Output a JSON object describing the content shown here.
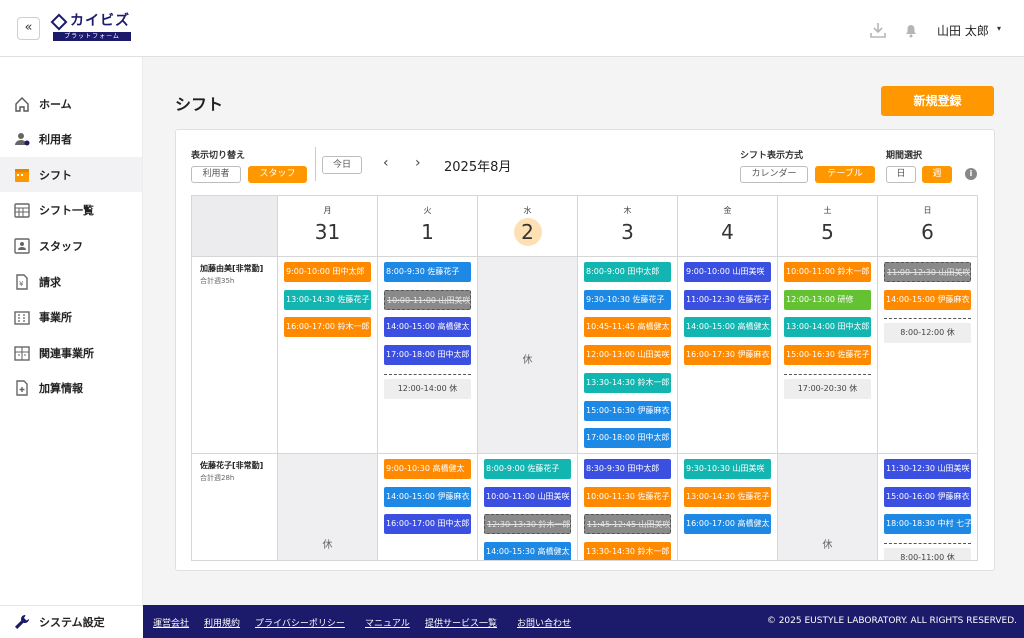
{
  "header": {
    "collapse_glyph": "«",
    "logo_main": "カイビズ",
    "logo_sub": "プラットフォーム",
    "user_name": "山田 太郎",
    "caret": "▾"
  },
  "sidebar": {
    "items": [
      {
        "label": "ホーム",
        "icon": "home-icon"
      },
      {
        "label": "利用者",
        "icon": "user-icon"
      },
      {
        "label": "シフト",
        "icon": "calendar-icon",
        "active": true
      },
      {
        "label": "シフト一覧",
        "icon": "calendar-grid-icon"
      },
      {
        "label": "スタッフ",
        "icon": "staff-card-icon"
      },
      {
        "label": "請求",
        "icon": "invoice-icon"
      },
      {
        "label": "事業所",
        "icon": "building-icon"
      },
      {
        "label": "関連事業所",
        "icon": "related-office-icon"
      },
      {
        "label": "加算情報",
        "icon": "document-plus-icon"
      }
    ],
    "system_setting": "システム設定"
  },
  "page": {
    "title": "シフト",
    "new_button": "新規登録"
  },
  "controls": {
    "view_switch_label": "表示切り替え",
    "view_user": "利用者",
    "view_staff": "スタッフ",
    "today": "今日",
    "prev": "‹",
    "next": "›",
    "month": "2025年8月",
    "display_mode_label": "シフト表示方式",
    "mode_calendar": "カレンダー",
    "mode_table": "テーブル",
    "period_label": "期間選択",
    "period_day": "日",
    "period_week": "週",
    "info": "i"
  },
  "colors": {
    "accent": "#ff9800",
    "navy": "#1b1a6b",
    "blue": "#3b50e0",
    "lightblue": "#1e88e5",
    "teal": "#12b5b0",
    "orange": "#ff8a00",
    "green": "#63c132",
    "gray": "#8a8a8a"
  },
  "days": [
    {
      "dow": "月",
      "num": "31"
    },
    {
      "dow": "火",
      "num": "1"
    },
    {
      "dow": "水",
      "num": "2",
      "today": true
    },
    {
      "dow": "木",
      "num": "3"
    },
    {
      "dow": "金",
      "num": "4"
    },
    {
      "dow": "土",
      "num": "5"
    },
    {
      "dow": "日",
      "num": "6"
    }
  ],
  "staff": [
    {
      "name": "加藤由美[非常勤]",
      "hours": "合計週35h"
    },
    {
      "name": "佐藤花子[非常勤]",
      "hours": "合計週28h"
    }
  ],
  "off_label": "休",
  "rows": [
    [
      {
        "shifts": [
          {
            "text": "9:00-10:00 田中太郎",
            "color": "orange"
          },
          {
            "text": "13:00-14:30 佐藤花子",
            "color": "teal"
          },
          {
            "text": "16:00-17:00 鈴木一郎",
            "color": "orange"
          }
        ]
      },
      {
        "shifts": [
          {
            "text": "8:00-9:30 佐藤花子",
            "color": "lightblue"
          },
          {
            "text": "10:00-11:00 山田美咲",
            "color": "gray",
            "cancel": true
          },
          {
            "text": "14:00-15:00 高橋健太",
            "color": "blue"
          },
          {
            "text": "17:00-18:00 田中太郎",
            "color": "blue"
          }
        ],
        "rest": "12:00-14:00 休"
      },
      {
        "off": true
      },
      {
        "shifts": [
          {
            "text": "8:00-9:00 田中太郎",
            "color": "teal"
          },
          {
            "text": "9:30-10:30 佐藤花子",
            "color": "lightblue"
          },
          {
            "text": "10:45-11:45 高橋健太",
            "color": "orange"
          },
          {
            "text": "12:00-13:00 山田美咲",
            "color": "orange"
          },
          {
            "text": "13:30-14:30 鈴木一郎",
            "color": "teal"
          },
          {
            "text": "15:00-16:30 伊藤麻衣",
            "color": "lightblue"
          },
          {
            "text": "17:00-18:00 田中太郎",
            "color": "lightblue"
          }
        ]
      },
      {
        "shifts": [
          {
            "text": "9:00-10:00 山田美咲",
            "color": "blue"
          },
          {
            "text": "11:00-12:30 佐藤花子",
            "color": "blue"
          },
          {
            "text": "14:00-15:00 高橋健太",
            "color": "teal"
          },
          {
            "text": "16:00-17:30 伊藤麻衣",
            "color": "orange"
          }
        ]
      },
      {
        "shifts": [
          {
            "text": "10:00-11:00 鈴木一郎",
            "color": "orange"
          },
          {
            "text": "12:00-13:00 研修",
            "color": "green"
          },
          {
            "text": "13:00-14:00 田中太郎",
            "color": "teal"
          },
          {
            "text": "15:00-16:30 佐藤花子",
            "color": "orange"
          }
        ],
        "rest": "17:00-20:30 休"
      },
      {
        "shifts": [
          {
            "text": "11:00-12:30 山田美咲",
            "color": "gray",
            "cancel": true
          },
          {
            "text": "14:00-15:00 伊藤麻衣",
            "color": "orange"
          }
        ],
        "rest": "8:00-12:00 休"
      }
    ],
    [
      {
        "off": true
      },
      {
        "shifts": [
          {
            "text": "9:00-10:30 高橋健太",
            "color": "orange"
          },
          {
            "text": "14:00-15:00 伊藤麻衣",
            "color": "lightblue"
          },
          {
            "text": "16:00-17:00 田中太郎",
            "color": "blue"
          }
        ]
      },
      {
        "shifts": [
          {
            "text": "8:00-9:00 佐藤花子",
            "color": "teal"
          },
          {
            "text": "10:00-11:00 山田美咲",
            "color": "blue"
          },
          {
            "text": "12:30-13:30 鈴木一郎",
            "color": "gray",
            "cancel": true
          },
          {
            "text": "14:00-15:30 高橋健太",
            "color": "lightblue"
          }
        ]
      },
      {
        "shifts": [
          {
            "text": "8:30-9:30 田中太郎",
            "color": "blue"
          },
          {
            "text": "10:00-11:30 佐藤花子",
            "color": "orange"
          },
          {
            "text": "11:45-12:45 山田美咲",
            "color": "gray",
            "cancel": true
          },
          {
            "text": "13:30-14:30 鈴木一郎",
            "color": "orange"
          }
        ]
      },
      {
        "shifts": [
          {
            "text": "9:30-10:30 山田美咲",
            "color": "teal"
          },
          {
            "text": "13:00-14:30 佐藤花子",
            "color": "orange"
          },
          {
            "text": "16:00-17:00 高橋健太",
            "color": "lightblue"
          }
        ]
      },
      {
        "off": true
      },
      {
        "shifts": [
          {
            "text": "11:30-12:30 山田美咲",
            "color": "blue"
          },
          {
            "text": "15:00-16:00 伊藤麻衣",
            "color": "blue"
          },
          {
            "text": "18:00-18:30 中村 七子",
            "color": "lightblue"
          }
        ],
        "rest": "8:00-11:00 休"
      }
    ]
  ],
  "footer": {
    "links": [
      "運営会社",
      "利用規約",
      "プライバシーポリシー",
      "マニュアル",
      "提供サービス一覧",
      "お問い合わせ"
    ],
    "copyright": "© 2025 EUSTYLE LABORATORY. ALL RIGHTS RESERVED."
  }
}
